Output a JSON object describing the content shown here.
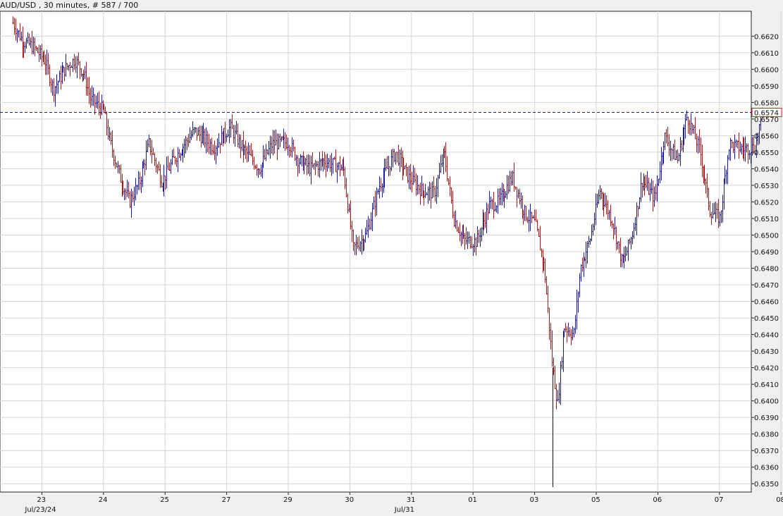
{
  "header": {
    "symbol": "AUD/USD",
    "interval": "30 minutes",
    "count_text": "# 587 / 700"
  },
  "chart_data": {
    "type": "bar",
    "title": "AUD/USD , 30 minutes, # 587 / 700",
    "y_axis": {
      "position": "right",
      "min": 0.6345,
      "max": 0.6635,
      "tick_step": 0.001,
      "tick_labels": [
        "0.6350",
        "0.6360",
        "0.6370",
        "0.6380",
        "0.6390",
        "0.6400",
        "0.6410",
        "0.6420",
        "0.6430",
        "0.6440",
        "0.6450",
        "0.6460",
        "0.6470",
        "0.6480",
        "0.6490",
        "0.6500",
        "0.6510",
        "0.6520",
        "0.6530",
        "0.6540",
        "0.6550",
        "0.6560",
        "0.6570",
        "0.6580",
        "0.6590",
        "0.6600",
        "0.6610",
        "0.6620"
      ]
    },
    "x_axis": {
      "days": [
        "23",
        "24",
        "25",
        "27",
        "29",
        "30",
        "31",
        "01",
        "03",
        "05",
        "06",
        "07",
        "08"
      ],
      "sub_labels": [
        {
          "text": "Jul/23/24",
          "under": "23"
        },
        {
          "text": "Jul/31",
          "under": "31"
        }
      ],
      "day_index": [
        0.09,
        0.28,
        0.47,
        0.66,
        0.85,
        1.04,
        1.23,
        1.42,
        1.61,
        1.8,
        1.99,
        2.18,
        2.37
      ]
    },
    "grid": true,
    "current_price": {
      "value": 0.6574,
      "label": "0.6574",
      "line": "dashed"
    },
    "colors": {
      "up": "#1a1aa8",
      "down": "#b01818",
      "grid": "#d4d4d4",
      "price_line": "#1a1aa8",
      "price_label_border": "#d02020"
    },
    "series_anchors": [
      {
        "t": 0.0,
        "p": 0.6628
      },
      {
        "t": 0.03,
        "p": 0.6617
      },
      {
        "t": 0.06,
        "p": 0.6614
      },
      {
        "t": 0.1,
        "p": 0.6605
      },
      {
        "t": 0.125,
        "p": 0.6588
      },
      {
        "t": 0.16,
        "p": 0.66
      },
      {
        "t": 0.19,
        "p": 0.6606
      },
      {
        "t": 0.22,
        "p": 0.6597
      },
      {
        "t": 0.24,
        "p": 0.6582
      },
      {
        "t": 0.28,
        "p": 0.6575
      },
      {
        "t": 0.3,
        "p": 0.6556
      },
      {
        "t": 0.33,
        "p": 0.6535
      },
      {
        "t": 0.36,
        "p": 0.652
      },
      {
        "t": 0.39,
        "p": 0.6532
      },
      {
        "t": 0.42,
        "p": 0.6555
      },
      {
        "t": 0.46,
        "p": 0.6532
      },
      {
        "t": 0.5,
        "p": 0.6547
      },
      {
        "t": 0.56,
        "p": 0.6563
      },
      {
        "t": 0.62,
        "p": 0.6553
      },
      {
        "t": 0.67,
        "p": 0.6565
      },
      {
        "t": 0.71,
        "p": 0.6552
      },
      {
        "t": 0.76,
        "p": 0.654
      },
      {
        "t": 0.8,
        "p": 0.6555
      },
      {
        "t": 0.85,
        "p": 0.6556
      },
      {
        "t": 0.88,
        "p": 0.6545
      },
      {
        "t": 0.92,
        "p": 0.654
      },
      {
        "t": 0.96,
        "p": 0.6545
      },
      {
        "t": 1.02,
        "p": 0.654
      },
      {
        "t": 1.05,
        "p": 0.6492
      },
      {
        "t": 1.09,
        "p": 0.65
      },
      {
        "t": 1.13,
        "p": 0.653
      },
      {
        "t": 1.18,
        "p": 0.655
      },
      {
        "t": 1.22,
        "p": 0.6535
      },
      {
        "t": 1.26,
        "p": 0.6527
      },
      {
        "t": 1.3,
        "p": 0.6525
      },
      {
        "t": 1.33,
        "p": 0.655
      },
      {
        "t": 1.36,
        "p": 0.651
      },
      {
        "t": 1.39,
        "p": 0.6497
      },
      {
        "t": 1.43,
        "p": 0.6496
      },
      {
        "t": 1.47,
        "p": 0.6518
      },
      {
        "t": 1.5,
        "p": 0.652
      },
      {
        "t": 1.54,
        "p": 0.6535
      },
      {
        "t": 1.58,
        "p": 0.6513
      },
      {
        "t": 1.61,
        "p": 0.6507
      },
      {
        "t": 1.64,
        "p": 0.648
      },
      {
        "t": 1.665,
        "p": 0.642
      },
      {
        "t": 1.68,
        "p": 0.6398
      },
      {
        "t": 1.7,
        "p": 0.6445
      },
      {
        "t": 1.73,
        "p": 0.644
      },
      {
        "t": 1.75,
        "p": 0.648
      },
      {
        "t": 1.78,
        "p": 0.6497
      },
      {
        "t": 1.81,
        "p": 0.6527
      },
      {
        "t": 1.85,
        "p": 0.6508
      },
      {
        "t": 1.88,
        "p": 0.6482
      },
      {
        "t": 1.91,
        "p": 0.65
      },
      {
        "t": 1.94,
        "p": 0.6533
      },
      {
        "t": 1.98,
        "p": 0.6522
      },
      {
        "t": 2.01,
        "p": 0.656
      },
      {
        "t": 2.05,
        "p": 0.6545
      },
      {
        "t": 2.08,
        "p": 0.6572
      },
      {
        "t": 2.12,
        "p": 0.655
      },
      {
        "t": 2.15,
        "p": 0.6515
      },
      {
        "t": 2.18,
        "p": 0.651
      },
      {
        "t": 2.21,
        "p": 0.6555
      },
      {
        "t": 2.25,
        "p": 0.6552
      },
      {
        "t": 2.29,
        "p": 0.6553
      },
      {
        "t": 2.31,
        "p": 0.6574
      }
    ],
    "spikes": [
      {
        "t": 1.665,
        "low": 0.6348
      }
    ]
  }
}
